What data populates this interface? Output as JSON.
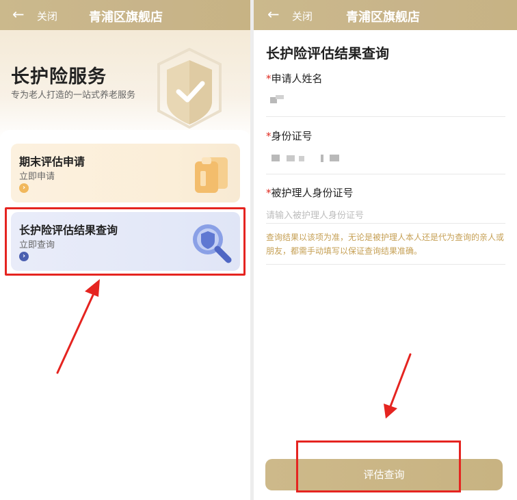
{
  "left": {
    "topbar": {
      "back_glyph": "←",
      "close_label": "关闭",
      "title": "青浦区旗舰店"
    },
    "hero": {
      "title": "长护险服务",
      "subtitle": "专为老人打造的一站式养老服务",
      "icon": "shield-check-icon"
    },
    "cards": [
      {
        "title": "期末评估申请",
        "subtitle": "立即申请",
        "arrow_glyph": "›",
        "icon": "clipboard-icon"
      },
      {
        "title": "长护险评估结果查询",
        "subtitle": "立即查询",
        "arrow_glyph": "›",
        "icon": "search-icon"
      }
    ]
  },
  "right": {
    "topbar": {
      "back_glyph": "←",
      "close_label": "关闭",
      "title": "青浦区旗舰店"
    },
    "form": {
      "title": "长护险评估结果查询",
      "required_mark": "*",
      "fields": [
        {
          "label": "申请人姓名"
        },
        {
          "label": "身份证号"
        },
        {
          "label": "被护理人身份证号",
          "placeholder": "请输入被护理人身份证号"
        }
      ],
      "note": "查询结果以该项为准，无论是被护理人本人还是代为查询的亲人或朋友，都需手动填写以保证查询结果准确。",
      "submit_label": "评估查询"
    }
  },
  "colors": {
    "header_gold": "#c8b48a",
    "highlight_red": "#e52420",
    "note_gold": "#c6a055",
    "required_red": "#e02b20"
  }
}
